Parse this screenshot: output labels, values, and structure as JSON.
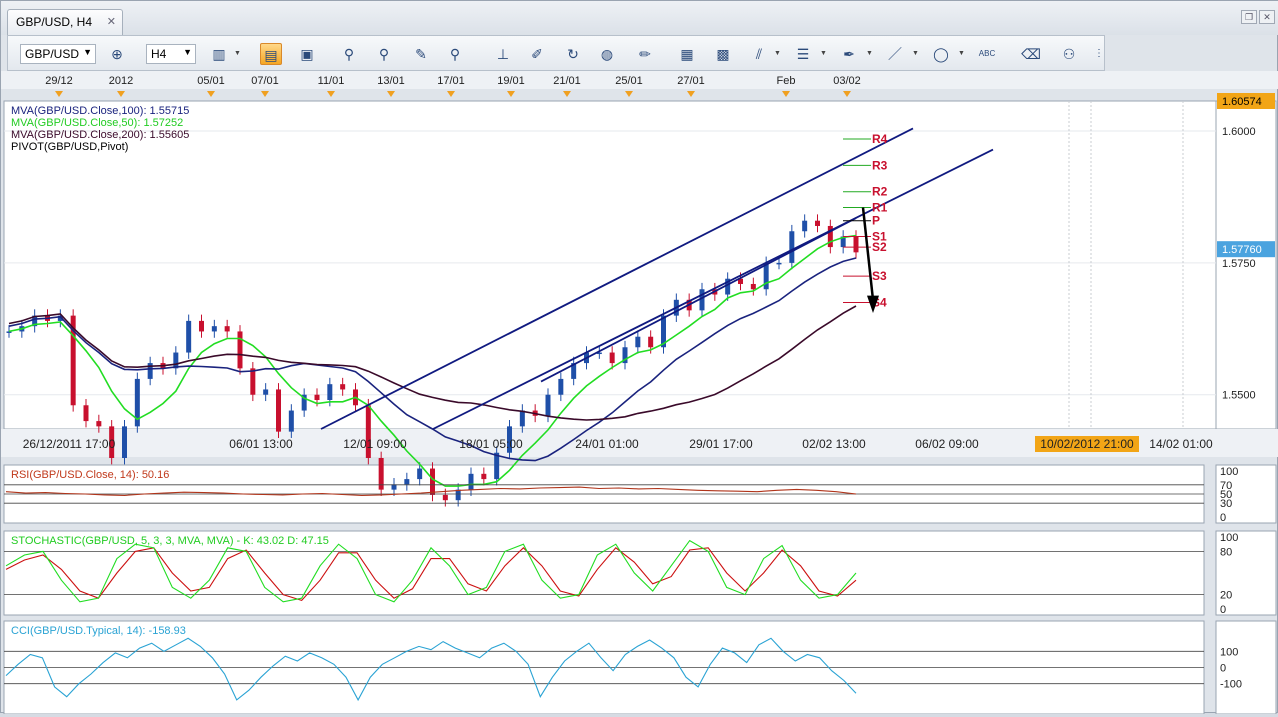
{
  "window": {
    "tab_title": "GBP/USD, H4",
    "restore_icon": "restore-icon",
    "close_icon": "close-icon"
  },
  "toolbar": {
    "symbol": "GBP/USD",
    "timeframe": "H4",
    "icons": [
      "crosshair-icon",
      "delete-icon",
      "bar-chart-icon",
      "candlestick-icon",
      "line-chart-icon",
      "indicators-icon",
      "studies-icon",
      "cursor-icon",
      "zoom-icon",
      "trend-icon",
      "drawing-icon",
      "refresh-icon",
      "globe-icon",
      "ruler-icon",
      "image-icon",
      "template-icon",
      "fibonacci-icon",
      "lines-icon",
      "pen-icon",
      "brush-icon",
      "ellipse-icon",
      "text-icon",
      "eraser-icon",
      "hierarchy-icon",
      "more-icon"
    ]
  },
  "top_time_labels": [
    "29/12",
    "2012",
    "05/01",
    "07/01",
    "11/01",
    "13/01",
    "17/01",
    "19/01",
    "21/01",
    "25/01",
    "27/01",
    "Feb",
    "03/02"
  ],
  "main_chart": {
    "legend": [
      {
        "text": "MVA(GBP/USD.Close,100): 1.55715",
        "color": "#1a237e"
      },
      {
        "text": "MVA(GBP/USD.Close,50): 1.57252",
        "color": "#22cc22"
      },
      {
        "text": "MVA(GBP/USD.Close,200): 1.55605",
        "color": "#3a0a2a"
      },
      {
        "text": "PIVOT(GBP/USD,Pivot)",
        "color": "#000000"
      }
    ],
    "price_labels": [
      "1.6000",
      "1.5750",
      "1.5500"
    ],
    "top_price_badge": "1.60574",
    "current_price_badge": "1.57760",
    "pivot_labels": [
      "R4",
      "R3",
      "R2",
      "R1",
      "P",
      "S1",
      "S2",
      "S3",
      "S4"
    ],
    "bottom_time_labels": [
      "26/12/2011 17:00",
      "06/01 13:00",
      "12/01 09:00",
      "18/01 05:00",
      "24/01 01:00",
      "29/01 17:00",
      "02/02 13:00",
      "06/02 09:00",
      "10/02/2012 21:00",
      "14/02 01:00"
    ],
    "highlighted_time": "10/02/2012 21:00"
  },
  "chart_data": [
    {
      "type": "candlestick",
      "title": "",
      "series": [
        {
          "name": "MVA(GBP/USD.Close,100)",
          "last": 1.55715
        },
        {
          "name": "MVA(GBP/USD.Close,50)",
          "last": 1.57252
        },
        {
          "name": "MVA(GBP/USD.Close,200)",
          "last": 1.55605
        }
      ],
      "ylim": [
        1.5435,
        1.6057
      ],
      "y_ticks": [
        1.6,
        1.575,
        1.55
      ],
      "last_price": 1.5776,
      "close_path": [
        1.562,
        1.563,
        1.565,
        1.564,
        1.565,
        1.548,
        1.545,
        1.544,
        1.538,
        1.544,
        1.553,
        1.556,
        1.555,
        1.558,
        1.564,
        1.562,
        1.563,
        1.562,
        1.555,
        1.55,
        1.551,
        1.543,
        1.547,
        1.55,
        1.549,
        1.552,
        1.551,
        1.548,
        1.538,
        1.532,
        1.533,
        1.534,
        1.536,
        1.531,
        1.53,
        1.532,
        1.535,
        1.534,
        1.539,
        1.544,
        1.547,
        1.546,
        1.55,
        1.553,
        1.556,
        1.558,
        1.558,
        1.556,
        1.559,
        1.561,
        1.559,
        1.565,
        1.568,
        1.566,
        1.57,
        1.569,
        1.572,
        1.571,
        1.57,
        1.575,
        1.575,
        1.581,
        1.583,
        1.582,
        1.578,
        1.58,
        1.577
      ],
      "pivot_levels": {
        "R4": 1.5985,
        "R3": 1.5935,
        "R2": 1.5885,
        "R1": 1.5855,
        "P": 1.583,
        "S1": 1.58,
        "S2": 1.578,
        "S3": 1.5725,
        "S4": 1.5675
      }
    },
    {
      "type": "line",
      "title": "RSI(GBP/USD.Close, 14): 50.16",
      "ylim": [
        0,
        100
      ],
      "y_ticks": [
        100,
        70,
        50,
        30,
        0
      ],
      "last": 50.16,
      "values": [
        55,
        52,
        53,
        51,
        50,
        48,
        47,
        50,
        52,
        54,
        53,
        52,
        50,
        49,
        48,
        50,
        51,
        49,
        47,
        48,
        50,
        52,
        55,
        58,
        60,
        62,
        61,
        63,
        64,
        65,
        62,
        63,
        61,
        62,
        60,
        58,
        57,
        56,
        55,
        58,
        60,
        58,
        55,
        50
      ]
    },
    {
      "type": "line",
      "title": "STOCHASTIC(GBP/USD, 5, 3, 3, MVA, MVA) -  K: 43.02  D: 47.15",
      "ylim": [
        0,
        100
      ],
      "y_ticks": [
        100,
        80,
        20,
        0
      ],
      "series": [
        {
          "name": "K",
          "last": 43.02,
          "values": [
            60,
            75,
            80,
            40,
            10,
            15,
            70,
            90,
            85,
            30,
            15,
            40,
            85,
            80,
            30,
            10,
            15,
            60,
            90,
            70,
            20,
            10,
            40,
            85,
            60,
            20,
            30,
            80,
            90,
            40,
            15,
            20,
            75,
            90,
            50,
            25,
            60,
            95,
            80,
            30,
            20,
            70,
            88,
            40,
            15,
            20,
            50
          ]
        },
        {
          "name": "D",
          "last": 47.15,
          "values": [
            55,
            68,
            75,
            55,
            25,
            15,
            50,
            80,
            85,
            50,
            25,
            30,
            70,
            82,
            50,
            20,
            12,
            40,
            78,
            78,
            40,
            15,
            28,
            70,
            70,
            35,
            25,
            60,
            85,
            60,
            25,
            18,
            55,
            85,
            65,
            35,
            45,
            82,
            85,
            50,
            25,
            50,
            82,
            60,
            25,
            18,
            40
          ]
        }
      ]
    },
    {
      "type": "line",
      "title": "CCI(GBP/USD.Typical, 14): -158.93",
      "ylim": [
        -250,
        250
      ],
      "y_ticks": [
        100,
        0,
        -100
      ],
      "last": -158.93,
      "values": [
        -50,
        20,
        80,
        60,
        -120,
        -180,
        -100,
        -40,
        30,
        90,
        60,
        120,
        150,
        100,
        140,
        180,
        130,
        60,
        -40,
        -200,
        -140,
        -60,
        10,
        70,
        40,
        90,
        60,
        20,
        -60,
        -200,
        -60,
        20,
        60,
        100,
        130,
        110,
        160,
        120,
        90,
        60,
        120,
        150,
        100,
        20,
        -180,
        -60,
        40,
        100,
        150,
        60,
        -20,
        80,
        130,
        170,
        120,
        60,
        -60,
        -120,
        20,
        120,
        90,
        30,
        140,
        180,
        100,
        40,
        80,
        60,
        -20,
        -80,
        -159
      ]
    }
  ]
}
